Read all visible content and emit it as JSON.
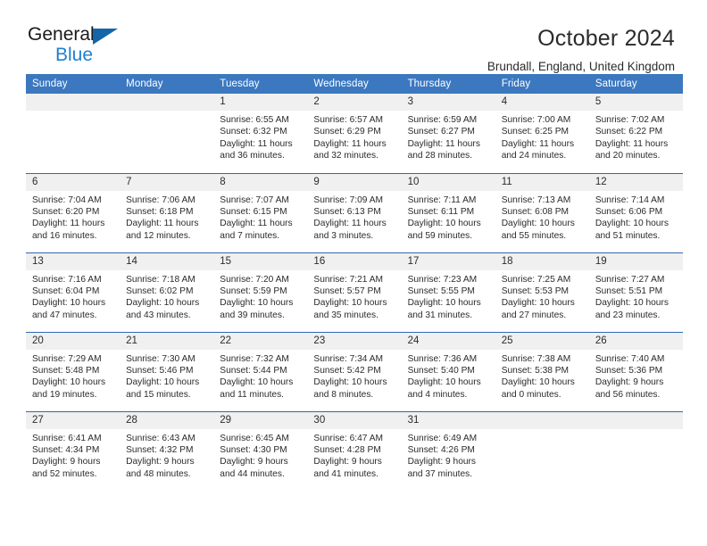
{
  "brand": {
    "name_part1": "General",
    "name_part2": "Blue",
    "triangle_icon": "blue-triangle-icon",
    "color_dark": "#1a1a1a",
    "color_blue": "#1f7fd1"
  },
  "header": {
    "title": "October 2024",
    "subtitle": "Brundall, England, United Kingdom",
    "accent_color": "#3b78bf",
    "row_divider_color": "#2d6ab3",
    "daynum_band_color": "#f0f0f0"
  },
  "weekday_headers": [
    "Sunday",
    "Monday",
    "Tuesday",
    "Wednesday",
    "Thursday",
    "Friday",
    "Saturday"
  ],
  "labels": {
    "sunrise_prefix": "Sunrise:",
    "sunset_prefix": "Sunset:",
    "daylight_prefix": "Daylight:"
  },
  "weeks": [
    [
      {
        "day": "",
        "blank": true
      },
      {
        "day": "",
        "blank": true
      },
      {
        "day": "1",
        "sunrise": "Sunrise: 6:55 AM",
        "sunset": "Sunset: 6:32 PM",
        "daylight_line1": "Daylight: 11 hours",
        "daylight_line2": "and 36 minutes."
      },
      {
        "day": "2",
        "sunrise": "Sunrise: 6:57 AM",
        "sunset": "Sunset: 6:29 PM",
        "daylight_line1": "Daylight: 11 hours",
        "daylight_line2": "and 32 minutes."
      },
      {
        "day": "3",
        "sunrise": "Sunrise: 6:59 AM",
        "sunset": "Sunset: 6:27 PM",
        "daylight_line1": "Daylight: 11 hours",
        "daylight_line2": "and 28 minutes."
      },
      {
        "day": "4",
        "sunrise": "Sunrise: 7:00 AM",
        "sunset": "Sunset: 6:25 PM",
        "daylight_line1": "Daylight: 11 hours",
        "daylight_line2": "and 24 minutes."
      },
      {
        "day": "5",
        "sunrise": "Sunrise: 7:02 AM",
        "sunset": "Sunset: 6:22 PM",
        "daylight_line1": "Daylight: 11 hours",
        "daylight_line2": "and 20 minutes."
      }
    ],
    [
      {
        "day": "6",
        "sunrise": "Sunrise: 7:04 AM",
        "sunset": "Sunset: 6:20 PM",
        "daylight_line1": "Daylight: 11 hours",
        "daylight_line2": "and 16 minutes."
      },
      {
        "day": "7",
        "sunrise": "Sunrise: 7:06 AM",
        "sunset": "Sunset: 6:18 PM",
        "daylight_line1": "Daylight: 11 hours",
        "daylight_line2": "and 12 minutes."
      },
      {
        "day": "8",
        "sunrise": "Sunrise: 7:07 AM",
        "sunset": "Sunset: 6:15 PM",
        "daylight_line1": "Daylight: 11 hours",
        "daylight_line2": "and 7 minutes."
      },
      {
        "day": "9",
        "sunrise": "Sunrise: 7:09 AM",
        "sunset": "Sunset: 6:13 PM",
        "daylight_line1": "Daylight: 11 hours",
        "daylight_line2": "and 3 minutes."
      },
      {
        "day": "10",
        "sunrise": "Sunrise: 7:11 AM",
        "sunset": "Sunset: 6:11 PM",
        "daylight_line1": "Daylight: 10 hours",
        "daylight_line2": "and 59 minutes."
      },
      {
        "day": "11",
        "sunrise": "Sunrise: 7:13 AM",
        "sunset": "Sunset: 6:08 PM",
        "daylight_line1": "Daylight: 10 hours",
        "daylight_line2": "and 55 minutes."
      },
      {
        "day": "12",
        "sunrise": "Sunrise: 7:14 AM",
        "sunset": "Sunset: 6:06 PM",
        "daylight_line1": "Daylight: 10 hours",
        "daylight_line2": "and 51 minutes."
      }
    ],
    [
      {
        "day": "13",
        "sunrise": "Sunrise: 7:16 AM",
        "sunset": "Sunset: 6:04 PM",
        "daylight_line1": "Daylight: 10 hours",
        "daylight_line2": "and 47 minutes."
      },
      {
        "day": "14",
        "sunrise": "Sunrise: 7:18 AM",
        "sunset": "Sunset: 6:02 PM",
        "daylight_line1": "Daylight: 10 hours",
        "daylight_line2": "and 43 minutes."
      },
      {
        "day": "15",
        "sunrise": "Sunrise: 7:20 AM",
        "sunset": "Sunset: 5:59 PM",
        "daylight_line1": "Daylight: 10 hours",
        "daylight_line2": "and 39 minutes."
      },
      {
        "day": "16",
        "sunrise": "Sunrise: 7:21 AM",
        "sunset": "Sunset: 5:57 PM",
        "daylight_line1": "Daylight: 10 hours",
        "daylight_line2": "and 35 minutes."
      },
      {
        "day": "17",
        "sunrise": "Sunrise: 7:23 AM",
        "sunset": "Sunset: 5:55 PM",
        "daylight_line1": "Daylight: 10 hours",
        "daylight_line2": "and 31 minutes."
      },
      {
        "day": "18",
        "sunrise": "Sunrise: 7:25 AM",
        "sunset": "Sunset: 5:53 PM",
        "daylight_line1": "Daylight: 10 hours",
        "daylight_line2": "and 27 minutes."
      },
      {
        "day": "19",
        "sunrise": "Sunrise: 7:27 AM",
        "sunset": "Sunset: 5:51 PM",
        "daylight_line1": "Daylight: 10 hours",
        "daylight_line2": "and 23 minutes."
      }
    ],
    [
      {
        "day": "20",
        "sunrise": "Sunrise: 7:29 AM",
        "sunset": "Sunset: 5:48 PM",
        "daylight_line1": "Daylight: 10 hours",
        "daylight_line2": "and 19 minutes."
      },
      {
        "day": "21",
        "sunrise": "Sunrise: 7:30 AM",
        "sunset": "Sunset: 5:46 PM",
        "daylight_line1": "Daylight: 10 hours",
        "daylight_line2": "and 15 minutes."
      },
      {
        "day": "22",
        "sunrise": "Sunrise: 7:32 AM",
        "sunset": "Sunset: 5:44 PM",
        "daylight_line1": "Daylight: 10 hours",
        "daylight_line2": "and 11 minutes."
      },
      {
        "day": "23",
        "sunrise": "Sunrise: 7:34 AM",
        "sunset": "Sunset: 5:42 PM",
        "daylight_line1": "Daylight: 10 hours",
        "daylight_line2": "and 8 minutes."
      },
      {
        "day": "24",
        "sunrise": "Sunrise: 7:36 AM",
        "sunset": "Sunset: 5:40 PM",
        "daylight_line1": "Daylight: 10 hours",
        "daylight_line2": "and 4 minutes."
      },
      {
        "day": "25",
        "sunrise": "Sunrise: 7:38 AM",
        "sunset": "Sunset: 5:38 PM",
        "daylight_line1": "Daylight: 10 hours",
        "daylight_line2": "and 0 minutes."
      },
      {
        "day": "26",
        "sunrise": "Sunrise: 7:40 AM",
        "sunset": "Sunset: 5:36 PM",
        "daylight_line1": "Daylight: 9 hours",
        "daylight_line2": "and 56 minutes."
      }
    ],
    [
      {
        "day": "27",
        "sunrise": "Sunrise: 6:41 AM",
        "sunset": "Sunset: 4:34 PM",
        "daylight_line1": "Daylight: 9 hours",
        "daylight_line2": "and 52 minutes."
      },
      {
        "day": "28",
        "sunrise": "Sunrise: 6:43 AM",
        "sunset": "Sunset: 4:32 PM",
        "daylight_line1": "Daylight: 9 hours",
        "daylight_line2": "and 48 minutes."
      },
      {
        "day": "29",
        "sunrise": "Sunrise: 6:45 AM",
        "sunset": "Sunset: 4:30 PM",
        "daylight_line1": "Daylight: 9 hours",
        "daylight_line2": "and 44 minutes."
      },
      {
        "day": "30",
        "sunrise": "Sunrise: 6:47 AM",
        "sunset": "Sunset: 4:28 PM",
        "daylight_line1": "Daylight: 9 hours",
        "daylight_line2": "and 41 minutes."
      },
      {
        "day": "31",
        "sunrise": "Sunrise: 6:49 AM",
        "sunset": "Sunset: 4:26 PM",
        "daylight_line1": "Daylight: 9 hours",
        "daylight_line2": "and 37 minutes."
      },
      {
        "day": "",
        "blank": true
      },
      {
        "day": "",
        "blank": true
      }
    ]
  ]
}
